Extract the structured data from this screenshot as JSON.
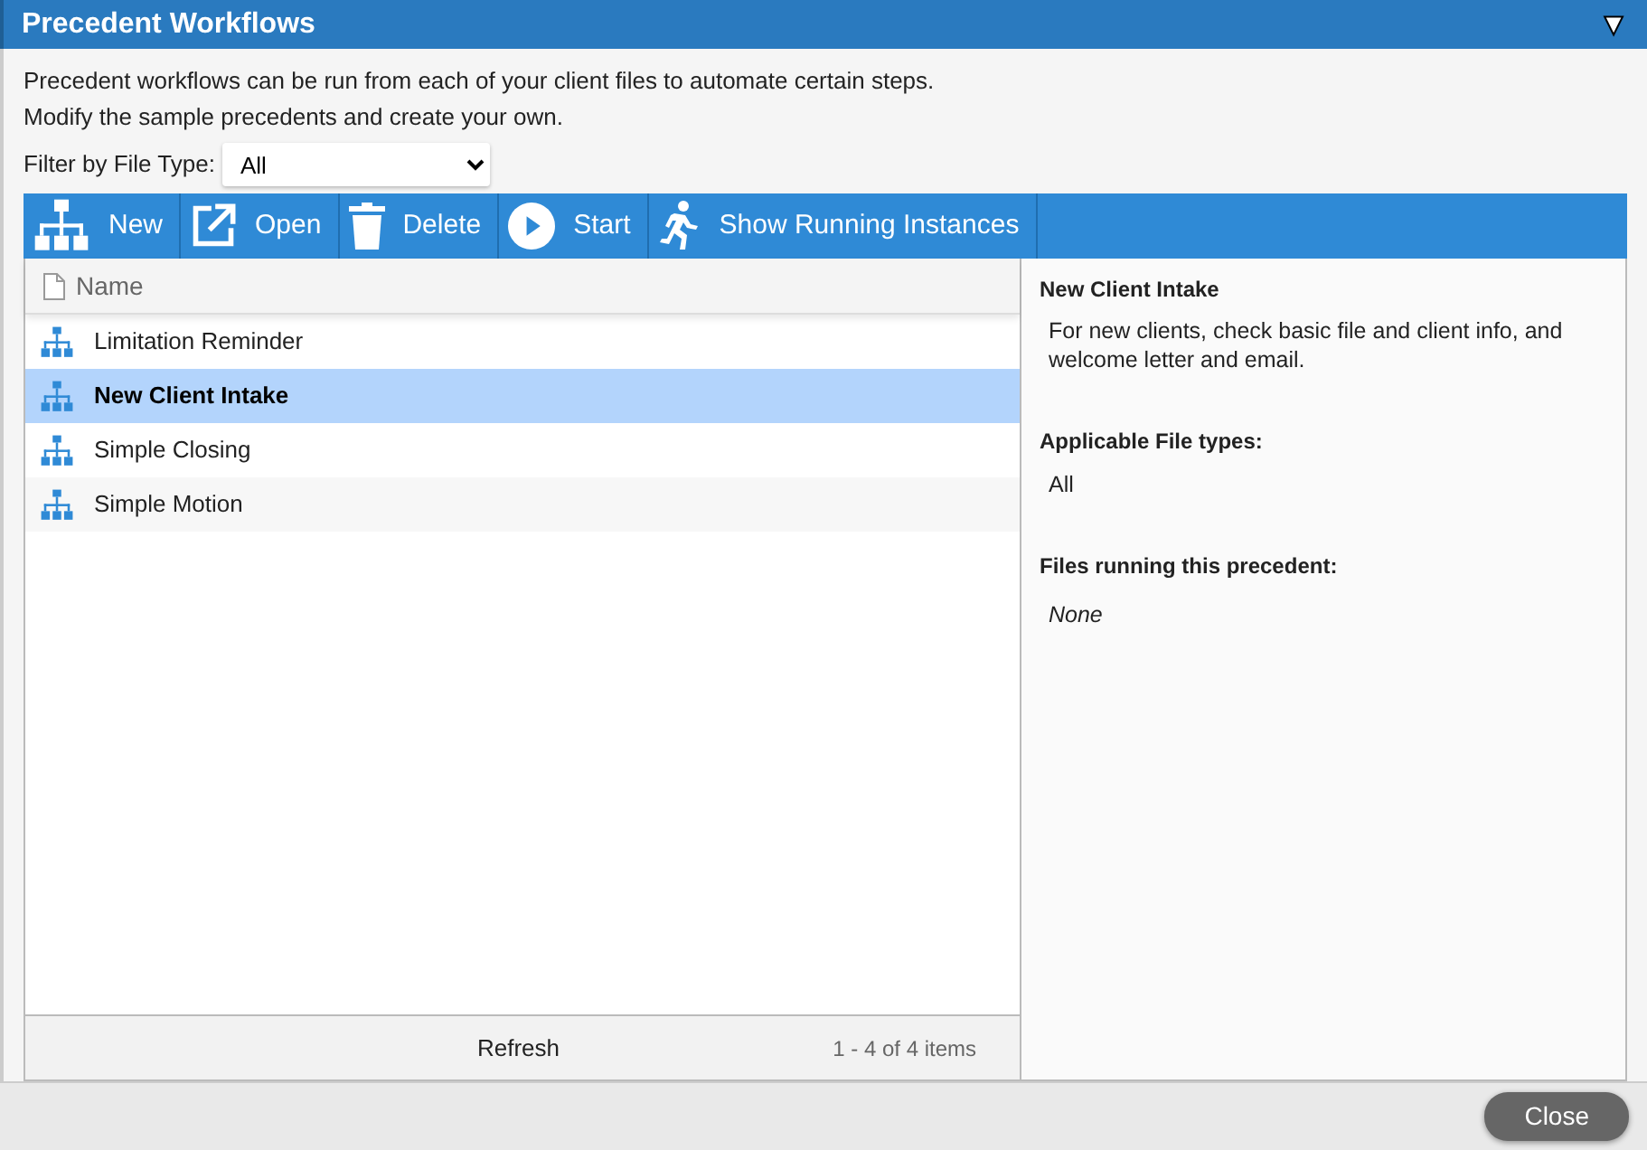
{
  "window": {
    "title": "Precedent Workflows",
    "collapse_glyph": "▼"
  },
  "intro": [
    "Precedent workflows can be run from each of your client files to automate certain steps.",
    "Modify the sample precedents and create your own."
  ],
  "filter": {
    "label": "Filter by File Type:",
    "value": "All"
  },
  "toolbar": [
    {
      "kind": "new",
      "label": "New"
    },
    {
      "kind": "open",
      "label": "Open"
    },
    {
      "kind": "delete",
      "label": "Delete"
    },
    {
      "kind": "start",
      "label": "Start"
    },
    {
      "kind": "running",
      "label": "Show Running Instances"
    }
  ],
  "table": {
    "columns": [
      "Name"
    ],
    "rows": [
      {
        "name": "Limitation Reminder",
        "selected": false
      },
      {
        "name": "New Client Intake",
        "selected": true
      },
      {
        "name": "Simple Closing",
        "selected": false
      },
      {
        "name": "Simple Motion",
        "selected": false
      }
    ],
    "refresh": "Refresh",
    "pager": "1 - 4 of 4 items"
  },
  "details": {
    "title": "New Client Intake",
    "description": "For new clients, check basic file and client info, and welcome letter and email.",
    "types_label": "Applicable File types:",
    "types": "All",
    "running_label": "Files running this precedent:",
    "running": "None"
  },
  "footer": {
    "close": "Close"
  }
}
